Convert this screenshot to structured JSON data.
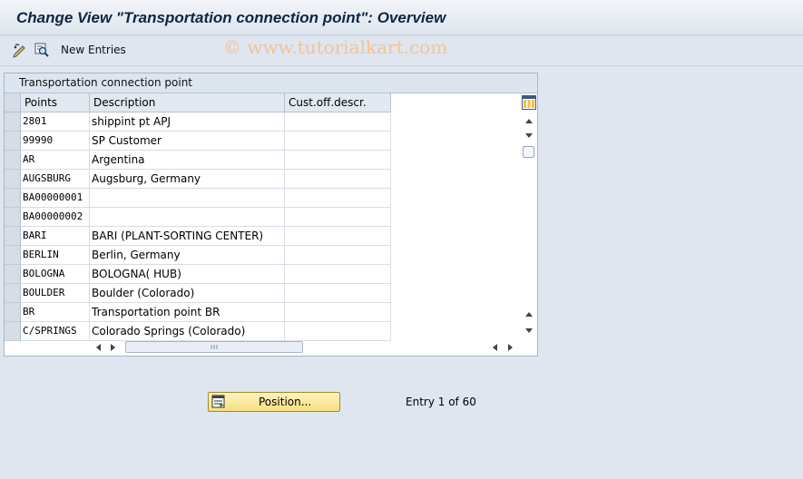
{
  "title": "Change View \"Transportation connection point\": Overview",
  "toolbar": {
    "new_entries_label": "New Entries"
  },
  "watermark": "© www.tutorialkart.com",
  "panel": {
    "title": "Transportation connection point"
  },
  "table": {
    "columns": [
      "Points",
      "Description",
      "Cust.off.descr."
    ],
    "rows": [
      {
        "point": "2801",
        "description": "shippint pt APJ",
        "cust": ""
      },
      {
        "point": "99990",
        "description": "SP Customer",
        "cust": ""
      },
      {
        "point": "AR",
        "description": "Argentina",
        "cust": ""
      },
      {
        "point": "AUGSBURG",
        "description": "Augsburg, Germany",
        "cust": ""
      },
      {
        "point": "BA00000001",
        "description": "",
        "cust": ""
      },
      {
        "point": "BA00000002",
        "description": "",
        "cust": ""
      },
      {
        "point": "BARI",
        "description": "BARI (PLANT-SORTING CENTER)",
        "cust": ""
      },
      {
        "point": "BERLIN",
        "description": "Berlin, Germany",
        "cust": ""
      },
      {
        "point": "BOLOGNA",
        "description": "BOLOGNA( HUB)",
        "cust": ""
      },
      {
        "point": "BOULDER",
        "description": "Boulder (Colorado)",
        "cust": ""
      },
      {
        "point": "BR",
        "description": "Transportation point BR",
        "cust": ""
      },
      {
        "point": "C/SPRINGS",
        "description": "Colorado Springs (Colorado)",
        "cust": ""
      }
    ]
  },
  "position_button": {
    "label": "Position..."
  },
  "entry_status": "Entry 1 of 60",
  "colors": {
    "button_bg": "#f6df7e",
    "background": "#dfe6ef",
    "title": "#10253f"
  }
}
